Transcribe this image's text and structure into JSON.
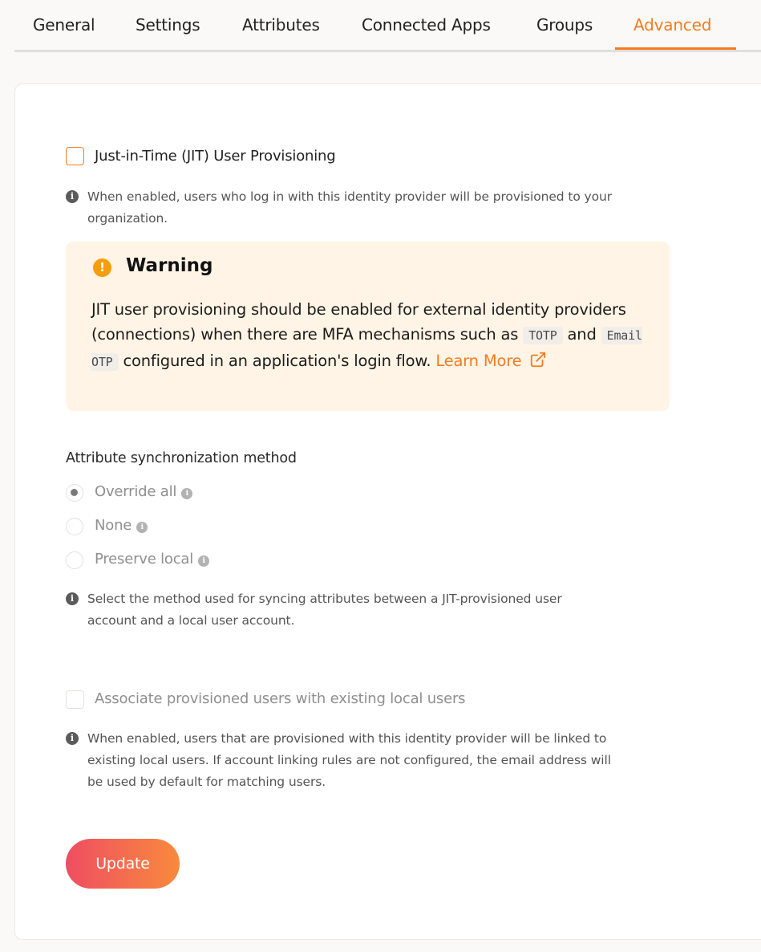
{
  "tabs": [
    {
      "label": "General"
    },
    {
      "label": "Settings"
    },
    {
      "label": "Attributes"
    },
    {
      "label": "Connected Apps"
    },
    {
      "label": "Groups"
    },
    {
      "label": "Advanced",
      "active": true
    }
  ],
  "jit": {
    "label": "Just-in-Time (JIT) User Provisioning",
    "checked": false,
    "hint_line1": "When enabled, users who log in with this identity provider will be provisioned to your",
    "hint_line2": "organization."
  },
  "warning": {
    "title": "Warning",
    "text_1": "JIT user provisioning should be enabled for external identity providers (connections) when there are MFA mechanisms such as",
    "code_1": "TOTP",
    "text_2": "and",
    "code_2": "Email OTP",
    "text_3": "configured in an application's login flow.",
    "link": "Learn More"
  },
  "sync": {
    "heading": "Attribute synchronization method",
    "options": [
      {
        "label": "Override all",
        "selected": true
      },
      {
        "label": "None",
        "selected": false
      },
      {
        "label": "Preserve local",
        "selected": false
      }
    ],
    "hint_line1": "Select the method used for syncing attributes between a JIT-provisioned user",
    "hint_line2": "account and a local user account."
  },
  "associate": {
    "label": "Associate provisioned users with existing local users",
    "checked": false,
    "hint_line1": "When enabled, users that are provisioned with this identity provider will be linked to",
    "hint_line2": "existing local users. If account linking rules are not configured, the email address will",
    "hint_line3": "be used by default for matching users."
  },
  "colors": {
    "accent": "#f47c20",
    "warning_bg": "#fff4e5",
    "warning_icon": "#f59e0b"
  },
  "update_label": "Update"
}
